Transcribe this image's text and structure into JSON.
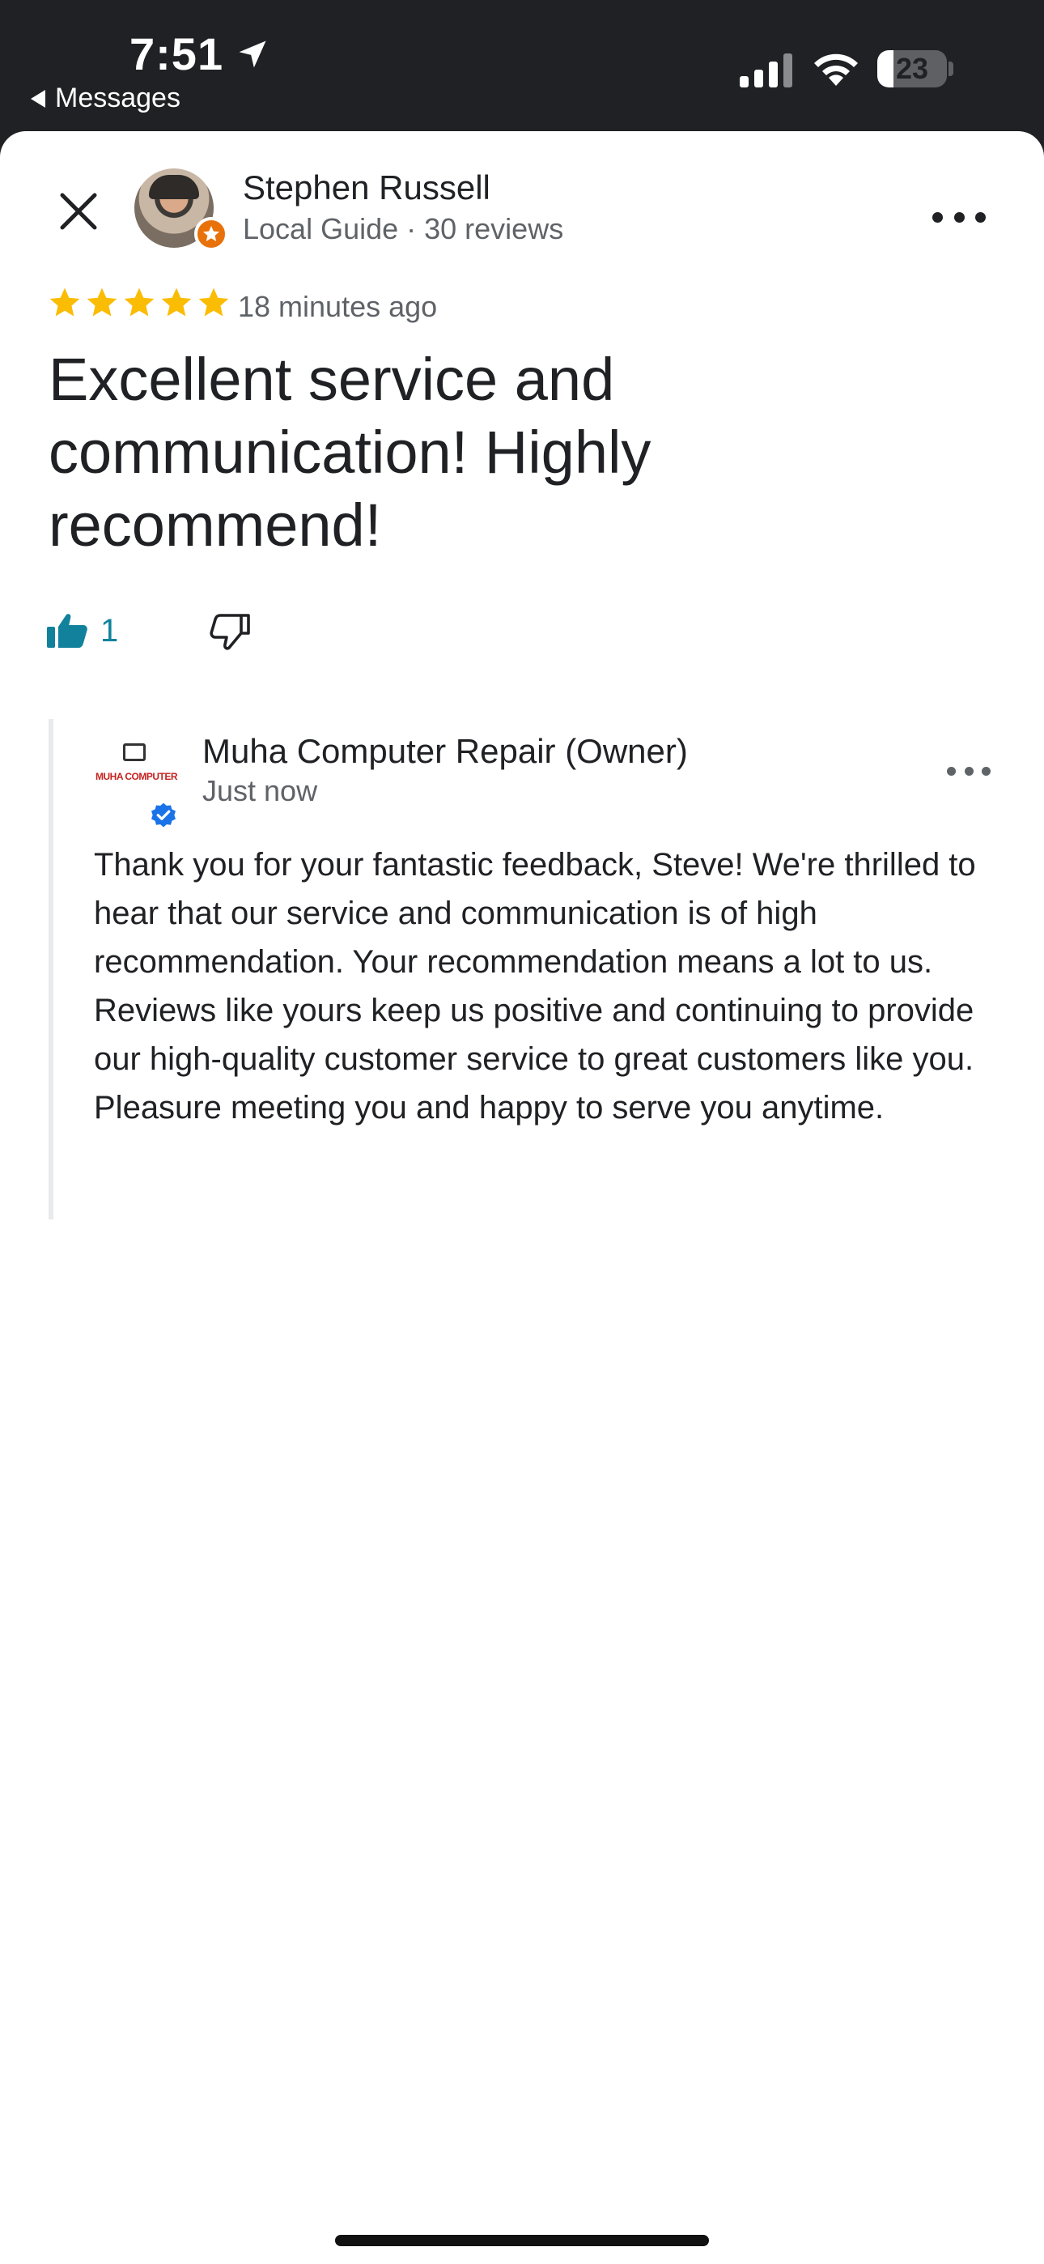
{
  "status_bar": {
    "time": "7:51",
    "back_app": "Messages",
    "battery_level": "23",
    "battery_fraction": 0.23,
    "icons": [
      "location-arrow-icon",
      "signal-icon",
      "wifi-icon",
      "battery-icon"
    ]
  },
  "review": {
    "reviewer_name": "Stephen Russell",
    "reviewer_meta": "Local Guide · 30 reviews",
    "rating": 5,
    "time_ago": "18 minutes ago",
    "title": "Excellent service and communication! Highly recommend!",
    "like_count": "1"
  },
  "owner_reply": {
    "name": "Muha Computer Repair (Owner)",
    "time": "Just now",
    "logo_text": "MUHA COMPUTER",
    "text": "Thank you for your fantastic feedback, Steve! We're thrilled to hear that our service and communication is of high recommendation. Your recommendation means a lot to us. Reviews like yours keep us positive and continuing to provide our high-quality customer service to great customers like you. Pleasure meeting you and happy to serve you anytime."
  },
  "colors": {
    "star": "#fbbc04",
    "like": "#12829c",
    "local_guide_badge": "#e8710a",
    "verified": "#1a73e8"
  }
}
